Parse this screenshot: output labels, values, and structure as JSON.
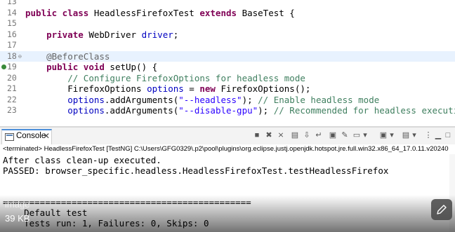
{
  "editor": {
    "lines": [
      {
        "num": "13",
        "segments": []
      },
      {
        "num": "14",
        "segments": [
          [
            "kw",
            "public class "
          ],
          [
            "",
            "HeadlessFirefoxTest "
          ],
          [
            "kw",
            "extends "
          ],
          [
            "",
            "BaseTest {"
          ]
        ]
      },
      {
        "num": "15",
        "segments": []
      },
      {
        "num": "16",
        "segments": [
          [
            "",
            "    "
          ],
          [
            "kw",
            "private "
          ],
          [
            "",
            "WebDriver "
          ],
          [
            "field",
            "driver"
          ],
          [
            "",
            ";"
          ]
        ]
      },
      {
        "num": "17",
        "segments": []
      },
      {
        "num": "18",
        "segments": [
          [
            "",
            "    "
          ],
          [
            "ann",
            "@BeforeClass"
          ]
        ]
      },
      {
        "num": "19",
        "segments": [
          [
            "",
            "    "
          ],
          [
            "kw",
            "public void "
          ],
          [
            "",
            "setUp() {"
          ]
        ]
      },
      {
        "num": "20",
        "segments": [
          [
            "",
            "        "
          ],
          [
            "cm",
            "// Configure FirefoxOptions for headless mode"
          ]
        ]
      },
      {
        "num": "21",
        "segments": [
          [
            "",
            "        FirefoxOptions "
          ],
          [
            "field",
            "options"
          ],
          [
            "",
            " = "
          ],
          [
            "kw",
            "new "
          ],
          [
            "",
            "FirefoxOptions();"
          ]
        ]
      },
      {
        "num": "22",
        "segments": [
          [
            "",
            "        "
          ],
          [
            "field",
            "options"
          ],
          [
            "",
            ".addArguments("
          ],
          [
            "str",
            "\"--headless\""
          ],
          [
            "",
            "); "
          ],
          [
            "cm",
            "// Enable headless mode"
          ]
        ]
      },
      {
        "num": "23",
        "segments": [
          [
            "",
            "        "
          ],
          [
            "field",
            "options"
          ],
          [
            "",
            ".addArguments("
          ],
          [
            "str",
            "\"--disable-gpu\""
          ],
          [
            "",
            "); "
          ],
          [
            "cm",
            "// Recommended for headless execution"
          ]
        ]
      }
    ]
  },
  "console": {
    "tab_label": "Console",
    "terminated_text": "<terminated> HeadlessFirefoxTest [TestNG] C:\\Users\\GFG0329\\.p2\\pool\\plugins\\org.eclipse.justj.openjdk.hotspot.jre.full.win32.x86_64_17.0.11.v20240",
    "lines": [
      "After class clean-up executed.",
      "PASSED: browser_specific.headless.HeadlessFirefoxTest.testHeadlessFirefox",
      "",
      "",
      "===============================================",
      "    Default test",
      "    Tests run: 1, Failures: 0, Skips: 0",
      "==============================================="
    ]
  },
  "overlay": {
    "label": "image",
    "size": "39 KB"
  },
  "colors": {
    "keyword": "#7f0055",
    "string": "#2a00ff",
    "comment": "#3f7f5f",
    "field": "#0000c0",
    "annotation": "#646464"
  }
}
